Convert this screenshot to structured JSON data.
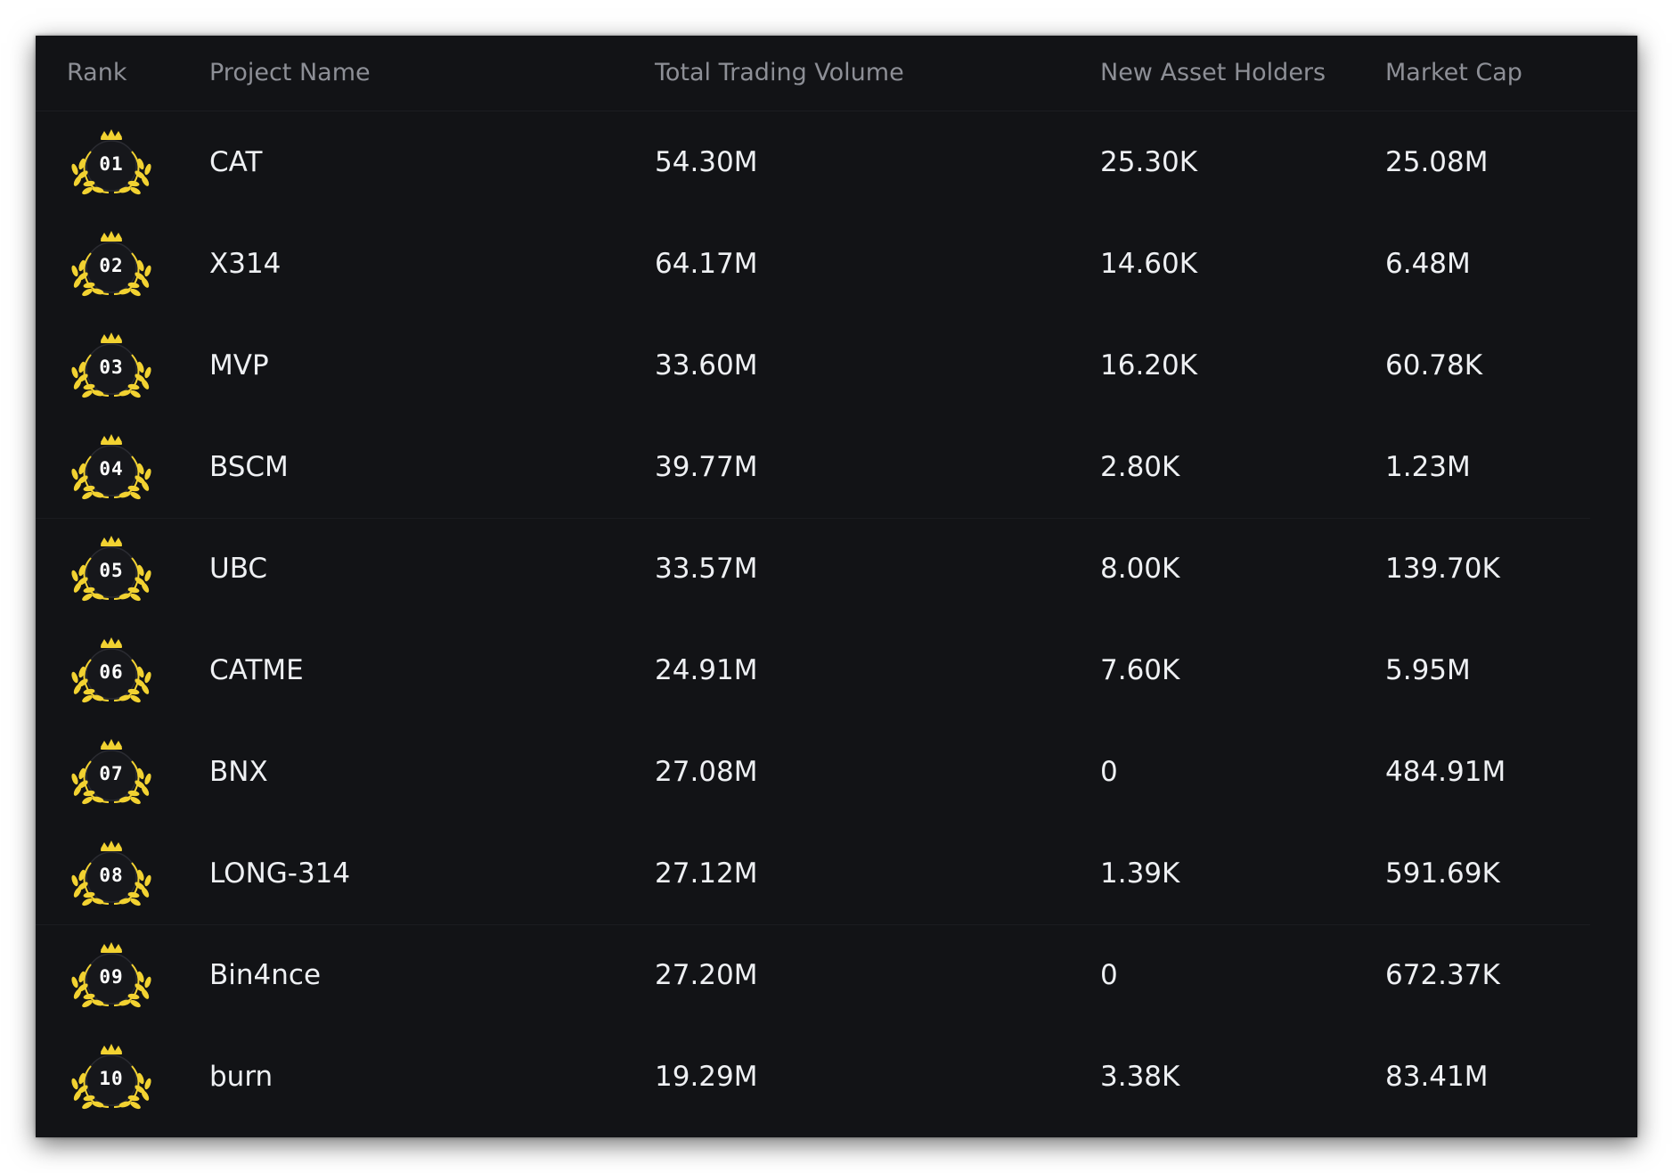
{
  "columns": {
    "rank": "Rank",
    "project_name": "Project Name",
    "total_trading_volume": "Total Trading Volume",
    "new_asset_holders": "New Asset Holders",
    "market_cap": "Market Cap"
  },
  "rows": [
    {
      "rank": "01",
      "name": "CAT",
      "volume": "54.30M",
      "holders": "25.30K",
      "market_cap": "25.08M"
    },
    {
      "rank": "02",
      "name": "X314",
      "volume": "64.17M",
      "holders": "14.60K",
      "market_cap": "6.48M"
    },
    {
      "rank": "03",
      "name": "MVP",
      "volume": "33.60M",
      "holders": "16.20K",
      "market_cap": "60.78K"
    },
    {
      "rank": "04",
      "name": "BSCM",
      "volume": "39.77M",
      "holders": "2.80K",
      "market_cap": "1.23M"
    },
    {
      "rank": "05",
      "name": "UBC",
      "volume": "33.57M",
      "holders": "8.00K",
      "market_cap": "139.70K"
    },
    {
      "rank": "06",
      "name": "CATME",
      "volume": "24.91M",
      "holders": "7.60K",
      "market_cap": "5.95M"
    },
    {
      "rank": "07",
      "name": "BNX",
      "volume": "27.08M",
      "holders": "0",
      "market_cap": "484.91M"
    },
    {
      "rank": "08",
      "name": "LONG-314",
      "volume": "27.12M",
      "holders": "1.39K",
      "market_cap": "591.69K"
    },
    {
      "rank": "09",
      "name": "Bin4nce",
      "volume": "27.20M",
      "holders": "0",
      "market_cap": "672.37K"
    },
    {
      "rank": "10",
      "name": "burn",
      "volume": "19.29M",
      "holders": "3.38K",
      "market_cap": "83.41M"
    }
  ],
  "icons": {
    "rank_badge": "crown-laurel-badge-icon"
  },
  "colors": {
    "background": "#121316",
    "header_text": "#8d8f96",
    "cell_text": "#eef0f3",
    "badge_gold": "#f2d231",
    "separator": "#1b1c20"
  }
}
